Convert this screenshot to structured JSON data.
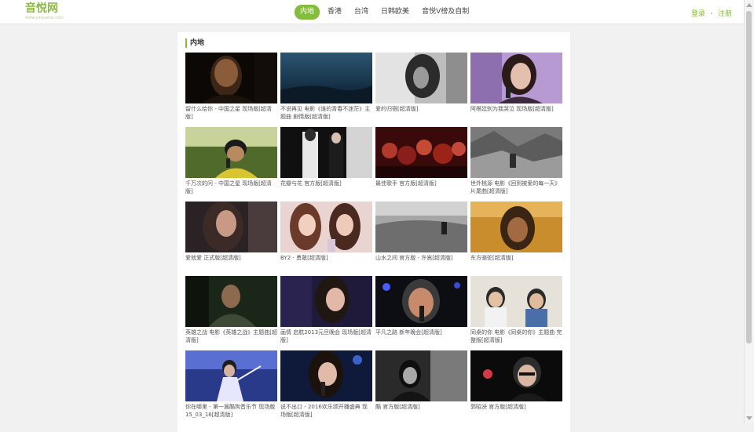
{
  "header": {
    "logo_text": "音悦网",
    "logo_sub": "www.yinyuetai.com",
    "nav": [
      {
        "label": "内地",
        "active": true
      },
      {
        "label": "香港",
        "active": false
      },
      {
        "label": "台湾",
        "active": false
      },
      {
        "label": "日韩欧美",
        "active": false
      },
      {
        "label": "音悦V榜及自制",
        "active": false
      }
    ],
    "login_label": "登录",
    "register_label": "注册"
  },
  "section": {
    "title": "内地"
  },
  "videos": [
    {
      "title": "留什么给你 - 中国之星 现场版[超清版]",
      "thumb": "thumb-1"
    },
    {
      "title": "不说再见 电影《谁的青春不迷茫》主题曲 剧情版[超清版]",
      "thumb": "thumb-2"
    },
    {
      "title": "爱的归宿[超清版]",
      "thumb": "thumb-3"
    },
    {
      "title": "阿根廷别为我哭泣 现场版[超清版]",
      "thumb": "thumb-4"
    },
    {
      "title": "千万次的问 - 中国之星 现场版[超清版]",
      "thumb": "thumb-5"
    },
    {
      "title": "花瓣与花 官方版[超清版]",
      "thumb": "thumb-6"
    },
    {
      "title": "最佳歌手 官方版[超清版]",
      "thumb": "thumb-7"
    },
    {
      "title": "世外桃源 电影《回到被爱的每一天》片尾曲[超清版]",
      "thumb": "thumb-8"
    },
    {
      "title": "爱就爱 正式版[超清版]",
      "thumb": "thumb-9"
    },
    {
      "title": "BY2 - 勇敢[超清版]",
      "thumb": "thumb-10"
    },
    {
      "title": "山水之间 官方版 - 许嵩[超清版]",
      "thumb": "thumb-11"
    },
    {
      "title": "东方骆驼[超清版]",
      "thumb": "thumb-12"
    },
    {
      "title": "英雄之战 电影《英雄之战》主题曲[超清版]",
      "thumb": "thumb-13"
    },
    {
      "title": "画情 启航2013元旦晚会 现场版[超清版]",
      "thumb": "thumb-14"
    },
    {
      "title": "平凡之路 新年晚会[超清版]",
      "thumb": "thumb-15"
    },
    {
      "title": "同桌的你 电影《同桌的你》主题曲 完整版[超清版]",
      "thumb": "thumb-16"
    },
    {
      "title": "你在哪里 - 第一届酷狗音乐节 现场版 15_03_16[超清版]",
      "thumb": "thumb-17"
    },
    {
      "title": "说不出口 - 2016欢乐颂开播盛典 现场版[超清版]",
      "thumb": "thumb-18"
    },
    {
      "title": "酷 官方版[超清版]",
      "thumb": "thumb-19"
    },
    {
      "title": "郭昭泱 官方版[超清版]",
      "thumb": "thumb-20"
    }
  ]
}
